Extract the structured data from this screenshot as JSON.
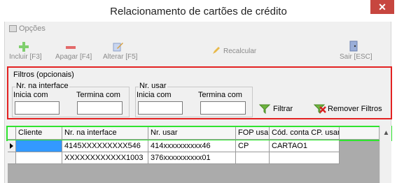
{
  "window": {
    "title": "Relacionamento de cartões de crédito",
    "close_glyph": "✕"
  },
  "menu": {
    "options_label": "Opções"
  },
  "toolbar": {
    "include_label": "Incluir [F3]",
    "delete_label": "Apagar [F4]",
    "edit_label": "Alterar [F5]",
    "recalc_label": "Recalcular",
    "exit_label": "Sair [ESC]",
    "icons": {
      "include": "plus-icon",
      "delete": "minus-icon",
      "edit": "edit-icon",
      "recalc": "pencil-icon",
      "exit": "exit-icon"
    },
    "disabled_color": "#8a8a8a"
  },
  "filters": {
    "title": "Filtros (opcionais)",
    "interface_group": {
      "title": "Nr. na interface",
      "starts_label": "Inicia com",
      "ends_label": "Termina com",
      "starts_value": "",
      "ends_value": ""
    },
    "use_group": {
      "title": "Nr. usar",
      "starts_label": "Inicia com",
      "ends_label": "Termina com",
      "starts_value": "",
      "ends_value": ""
    },
    "filter_button": "Filtrar",
    "remove_button": "Remover Filtros",
    "highlight_color": "#e32222"
  },
  "grid": {
    "columns": [
      "Cliente",
      "Nr. na interface",
      "Nr. usar",
      "FOP usar",
      "Cód. conta CP. usar"
    ],
    "rows": [
      [
        "",
        "4145XXXXXXXXX546",
        "414xxxxxxxxxx46",
        "CP",
        "CARTAO1"
      ],
      [
        "",
        "XXXXXXXXXXXX1003",
        "376xxxxxxxxxx01",
        "",
        ""
      ]
    ],
    "selection_color": "#3399ff",
    "header_highlight_color": "#2fe42f"
  }
}
